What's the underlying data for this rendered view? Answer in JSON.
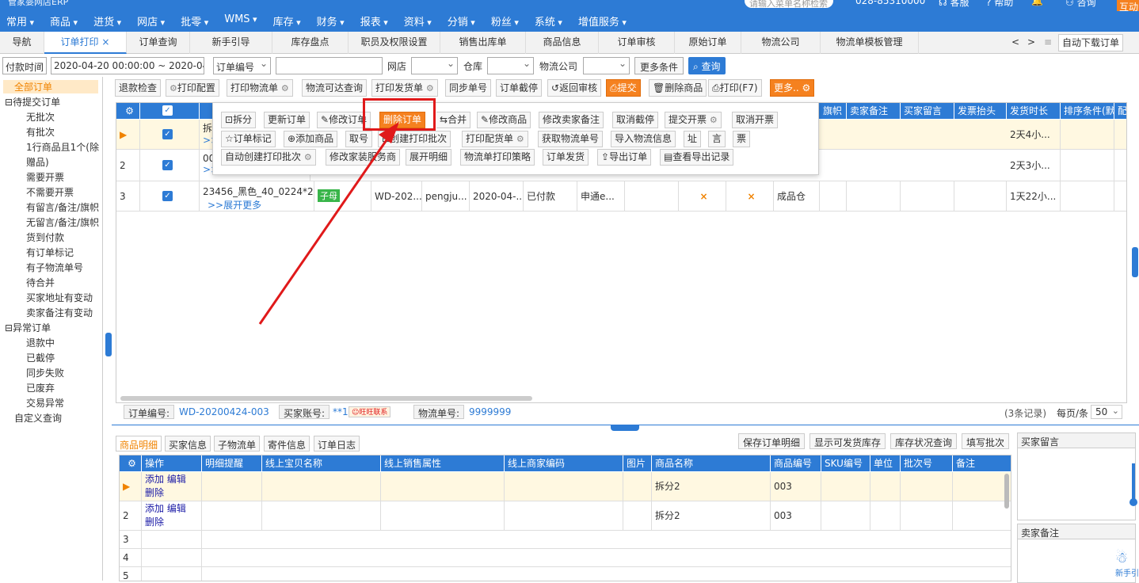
{
  "topnav": {
    "logo_text": "管家婆网店ERP",
    "menus": [
      "常用",
      "商品",
      "进货",
      "网店",
      "批零",
      "WMS",
      "库存",
      "财务",
      "报表",
      "资料",
      "分销",
      "粉丝",
      "系统",
      "增值服务"
    ],
    "search_placeholder": "请输入菜单名称检索",
    "phone": "028-85310000",
    "service": "客服",
    "help": "帮助",
    "user": "咨询",
    "badge": "互动"
  },
  "tabs": [
    "导航",
    "订单打印",
    "订单查询",
    "新手引导",
    "库存盘点",
    "职员及权限设置",
    "销售出库单",
    "商品信息",
    "订单审核",
    "原始订单",
    "物流公司",
    "物流单模板管理"
  ],
  "tab_close": "×",
  "tab_right": {
    "prev": "<",
    "next": ">",
    "menu": "≡",
    "auto": "自动下载订单"
  },
  "filter": {
    "time_type": "付款时间",
    "date_range": "2020-04-20 00:00:00 ~ 2020-04-2",
    "field": "订单编号",
    "value": "",
    "shop_label": "网店",
    "warehouse_label": "仓库",
    "logistics_label": "物流公司",
    "more": "更多条件",
    "query": "查询"
  },
  "sidebar": {
    "all": "全部订单",
    "pending_group": "待提交订单",
    "pending": [
      "无批次",
      "有批次",
      "1行商品且1个(除",
      "赠品)",
      "需要开票",
      "不需要开票",
      "有留言/备注/旗帜",
      "无留言/备注/旗帜",
      "货到付款",
      "有订单标记",
      "有子物流单号",
      "待合并",
      "买家地址有变动",
      "卖家备注有变动"
    ],
    "abnormal_group": "异常订单",
    "abnormal": [
      "退款中",
      "已截停",
      "同步失败",
      "已废弃",
      "交易异常"
    ],
    "custom": "自定义查询"
  },
  "toolbar": [
    "退款检查",
    "打印配置",
    "打印物流单",
    "物流可达查询",
    "打印发货单",
    "同步单号",
    "订单截停",
    "返回审核",
    "提交",
    "删除商品",
    "打印(F7)",
    "更多.."
  ],
  "popup": {
    "row1": [
      "拆分",
      "更新订单",
      "修改订单",
      "删除订单",
      "合并",
      "修改商品",
      "修改卖家备注",
      "取消截停",
      "提交开票",
      "取消开票"
    ],
    "row2": [
      "订单标记",
      "添加商品",
      "取号",
      "创建打印批次",
      "打印配货单",
      "获取物流单号",
      "导入物流信息",
      "址",
      "言",
      "票"
    ],
    "row3": [
      "自动创建打印批次",
      "修改家装服务商",
      "展开明细",
      "物流单打印策略",
      "订单发货",
      "导出订单",
      "查看导出记录"
    ]
  },
  "grid": {
    "headers_right": [
      "旗帜",
      "卖家备注",
      "买家留言",
      "发票抬头",
      "发货时长",
      "排序条件(默",
      "配"
    ],
    "rows": [
      {
        "no": "",
        "marker": "▶",
        "product": "拆",
        "expand": ">>",
        "wait": "2天4小..."
      },
      {
        "no": "2",
        "marker": "",
        "product": "00",
        "expand": ">>",
        "wait": "2天3小..."
      },
      {
        "no": "3",
        "marker": "",
        "product": "23456_黑色_40_0224*2",
        "expand": ">>展开更多",
        "tag": "子母",
        "order": "WD-202...",
        "buyer": "pengju...",
        "date": "2020-04-...",
        "status": "已付款",
        "logistics": "申通e...",
        "flag1": "×",
        "flag2": "×",
        "warehouse": "成品仓",
        "wait": "1天22小..."
      }
    ]
  },
  "status": {
    "order_label": "订单编号:",
    "order_value": "WD-20200424-003",
    "buyer_label": "买家账号:",
    "buyer_value": "**1",
    "contact": "旺旺联系",
    "tracking_label": "物流单号:",
    "tracking_value": "9999999",
    "records": "(3条记录)",
    "page_size_label": "每页/条",
    "page_size": "50"
  },
  "bottom": {
    "tabs": [
      "商品明细",
      "买家信息",
      "子物流单",
      "寄件信息",
      "订单日志"
    ],
    "actions": [
      "保存订单明细",
      "显示可发货库存",
      "库存状况查询",
      "填写批次"
    ],
    "headers": [
      "操作",
      "明细提醒",
      "线上宝贝名称",
      "线上销售属性",
      "线上商家编码",
      "图片",
      "商品名称",
      "商品编号",
      "SKU编号",
      "单位",
      "批次号",
      "备注"
    ],
    "rows": [
      {
        "no": "",
        "marker": "▶",
        "op1": "添加 编辑",
        "op2": "删除",
        "name": "拆分2",
        "code": "003"
      },
      {
        "no": "2",
        "marker": "",
        "op1": "添加 编辑",
        "op2": "删除",
        "name": "拆分2",
        "code": "003"
      },
      {
        "no": "3"
      },
      {
        "no": "4"
      },
      {
        "no": "5"
      }
    ],
    "buyer_msg_title": "买家留言",
    "seller_note_title": "卖家备注",
    "helper": "新手引"
  },
  "colors": {
    "primary": "#2d7bd5",
    "accent": "#f5811f",
    "highlight": "#e0191a"
  }
}
